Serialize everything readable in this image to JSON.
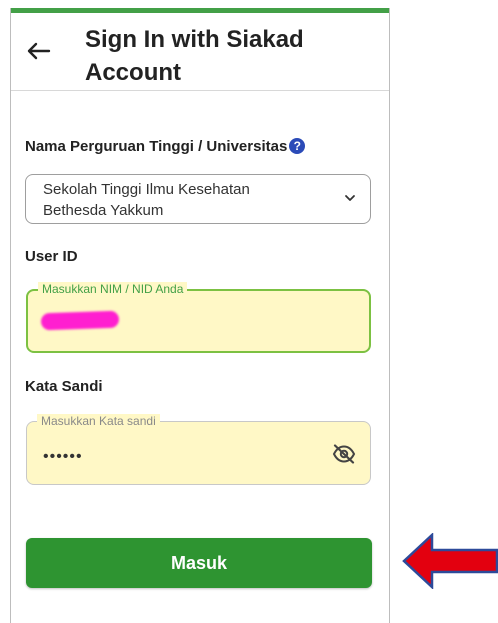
{
  "header": {
    "title": "Sign In with Siakad Account",
    "back_icon": "arrow-left-icon"
  },
  "university": {
    "label": "Nama Perguruan Tinggi / Universitas",
    "help_glyph": "?",
    "selected": "Sekolah Tinggi Ilmu Kesehatan Bethesda Yakkum"
  },
  "user_id": {
    "label": "User ID",
    "placeholder": "Masukkan NIM / NID Anda"
  },
  "password": {
    "label": "Kata Sandi",
    "placeholder": "Masukkan Kata sandi",
    "value": "••••••",
    "toggle_icon": "eye-off-icon"
  },
  "submit": {
    "label": "Masuk"
  },
  "colors": {
    "accent": "#2e9431",
    "field_bg": "#fff8c6",
    "focus_border": "#7cc142",
    "pointer_arrow": "#e3000f"
  }
}
